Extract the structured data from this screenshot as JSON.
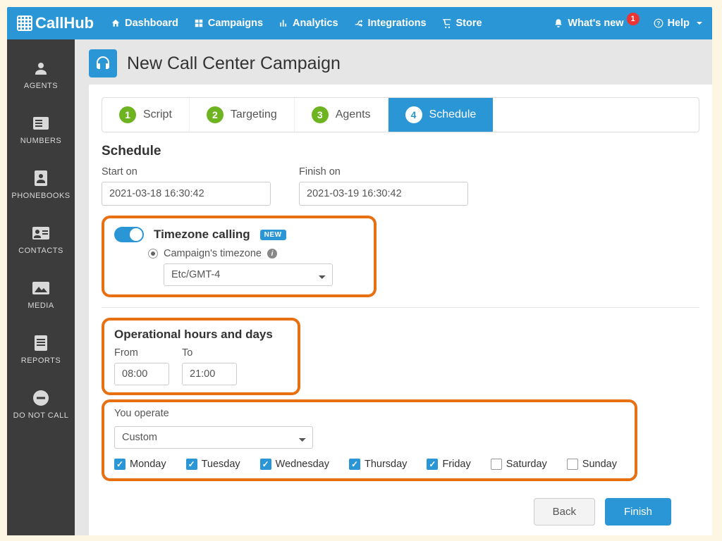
{
  "brand": "CallHub",
  "topnav": {
    "dashboard": "Dashboard",
    "campaigns": "Campaigns",
    "analytics": "Analytics",
    "integrations": "Integrations",
    "store": "Store",
    "whatsnew": "What's new",
    "whatsnew_badge": "1",
    "help": "Help"
  },
  "sidebar": {
    "agents": "AGENTS",
    "numbers": "NUMBERS",
    "phonebooks": "PHONEBOOKS",
    "contacts": "CONTACTS",
    "media": "MEDIA",
    "reports": "REPORTS",
    "donotcall": "DO NOT CALL"
  },
  "page": {
    "title": "New Call Center Campaign"
  },
  "wizard": {
    "step1": {
      "num": "1",
      "label": "Script"
    },
    "step2": {
      "num": "2",
      "label": "Targeting"
    },
    "step3": {
      "num": "3",
      "label": "Agents"
    },
    "step4": {
      "num": "4",
      "label": "Schedule"
    }
  },
  "schedule": {
    "heading": "Schedule",
    "start_label": "Start on",
    "start_value": "2021-03-18 16:30:42",
    "finish_label": "Finish on",
    "finish_value": "2021-03-19 16:30:42"
  },
  "timezone": {
    "title": "Timezone calling",
    "new_badge": "NEW",
    "option_label": "Campaign's timezone",
    "select_value": "Etc/GMT-4"
  },
  "operational": {
    "heading": "Operational hours and days",
    "from_label": "From",
    "from_value": "08:00",
    "to_label": "To",
    "to_value": "21:00"
  },
  "operate": {
    "label": "You operate",
    "select_value": "Custom",
    "days": {
      "mon": "Monday",
      "tue": "Tuesday",
      "wed": "Wednesday",
      "thu": "Thursday",
      "fri": "Friday",
      "sat": "Saturday",
      "sun": "Sunday"
    }
  },
  "buttons": {
    "back": "Back",
    "finish": "Finish"
  }
}
